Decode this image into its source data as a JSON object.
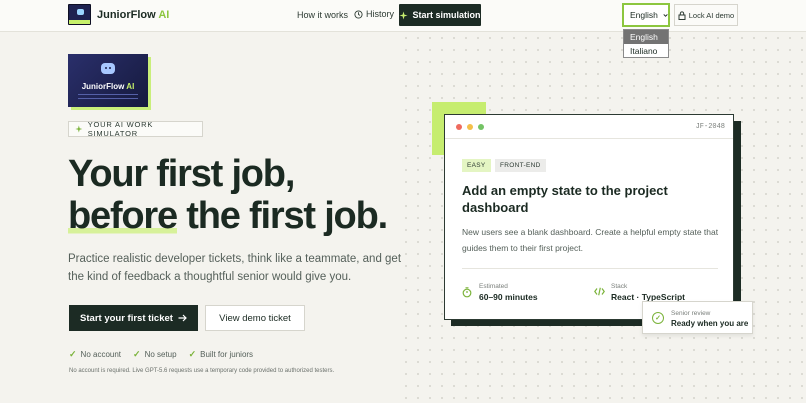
{
  "header": {
    "brand_name": "JuniorFlow",
    "brand_ai": "AI",
    "nav_how": "How it works",
    "nav_history": "History",
    "start_sim": "Start simulation",
    "language_selected": "English",
    "language_options": [
      "English",
      "Italiano"
    ],
    "lock_demo": "Lock AI demo"
  },
  "hero": {
    "logo_name": "JuniorFlow",
    "logo_ai": "AI",
    "badge": "YOUR AI WORK SIMULATOR",
    "headline_line1": "Your first job,",
    "headline_hl": "before",
    "headline_rest": " the first job.",
    "subtext": "Practice realistic developer tickets, think like a teammate, and get the kind of feedback a thoughtful senior would give you.",
    "cta_primary": "Start your first ticket",
    "cta_secondary": "View demo ticket",
    "checks": [
      "No account",
      "No setup",
      "Built for juniors"
    ],
    "footnote": "No account is required. Live GPT-5.6 requests use a temporary code provided to authorized testers."
  },
  "card": {
    "id": "JF-2048",
    "tags": [
      "EASY",
      "FRONT-END"
    ],
    "title": "Add an empty state to the project dashboard",
    "description": "New users see a blank dashboard. Create a helpful empty state that guides them to their first project.",
    "estimated_label": "Estimated",
    "estimated_value": "60–90 minutes",
    "stack_label": "Stack",
    "stack_value": "React · TypeScript"
  },
  "review": {
    "label": "Senior review",
    "value": "Ready when you are"
  },
  "colors": {
    "accent": "#c6ed6f",
    "dark": "#1c2b24",
    "background": "#f4f3ee"
  }
}
